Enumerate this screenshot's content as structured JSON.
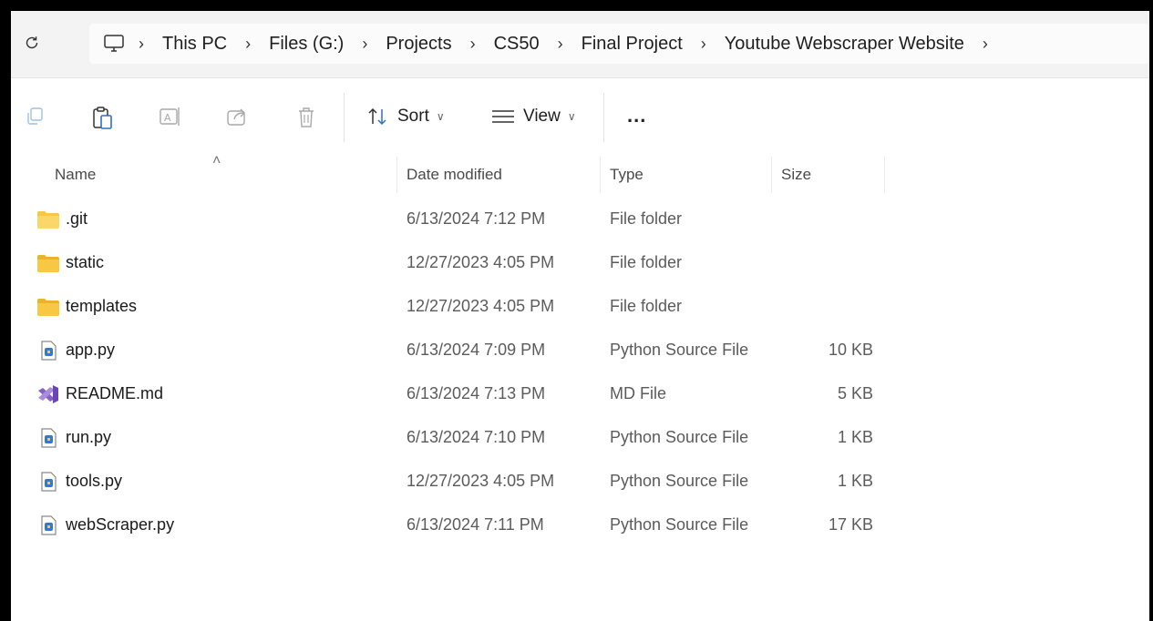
{
  "breadcrumb": {
    "items": [
      "This PC",
      "Files (G:)",
      "Projects",
      "CS50",
      "Final Project",
      "Youtube Webscraper Website"
    ]
  },
  "toolbar": {
    "buttons": [
      "copy-icon",
      "paste-icon",
      "rename-icon",
      "share-icon",
      "delete-icon"
    ],
    "sort_label": "Sort",
    "view_label": "View",
    "more_label": "..."
  },
  "columns": {
    "name": "Name",
    "date": "Date modified",
    "type": "Type",
    "size": "Size"
  },
  "files": [
    {
      "name": ".git",
      "date": "6/13/2024 7:12 PM",
      "type": "File folder",
      "size": "",
      "icon": "folder-icon"
    },
    {
      "name": "static",
      "date": "12/27/2023 4:05 PM",
      "type": "File folder",
      "size": "",
      "icon": "folder-icon"
    },
    {
      "name": "templates",
      "date": "12/27/2023 4:05 PM",
      "type": "File folder",
      "size": "",
      "icon": "folder-icon"
    },
    {
      "name": "app.py",
      "date": "6/13/2024 7:09 PM",
      "type": "Python Source File",
      "size": "10 KB",
      "icon": "python-file-icon"
    },
    {
      "name": "README.md",
      "date": "6/13/2024 7:13 PM",
      "type": "MD File",
      "size": "5 KB",
      "icon": "visual-studio-icon"
    },
    {
      "name": "run.py",
      "date": "6/13/2024 7:10 PM",
      "type": "Python Source File",
      "size": "1 KB",
      "icon": "python-file-icon"
    },
    {
      "name": "tools.py",
      "date": "12/27/2023 4:05 PM",
      "type": "Python Source File",
      "size": "1 KB",
      "icon": "python-file-icon"
    },
    {
      "name": "webScraper.py",
      "date": "6/13/2024 7:11 PM",
      "type": "Python Source File",
      "size": "17 KB",
      "icon": "python-file-icon"
    }
  ],
  "colors": {
    "folder": "#f7c843",
    "folder_dark": "#e9b42a",
    "vs_purple": "#8661c5",
    "python_blue": "#3b78c4"
  }
}
